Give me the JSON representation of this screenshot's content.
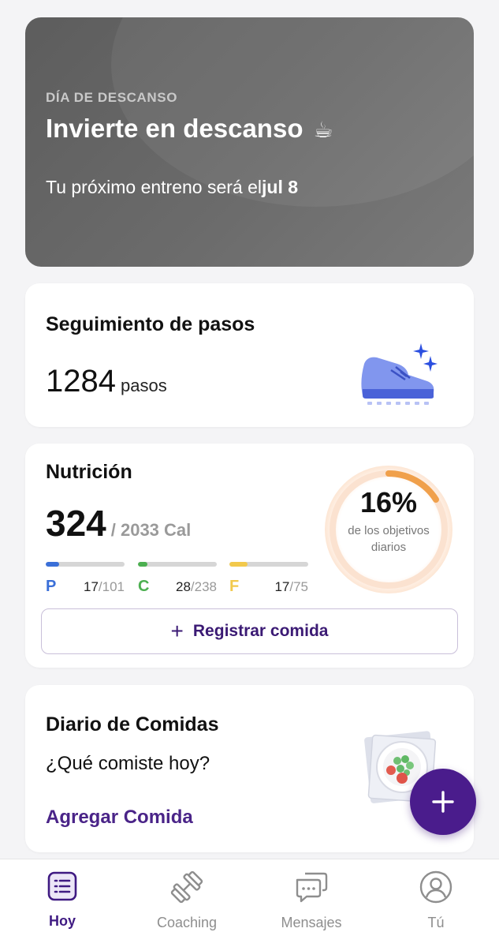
{
  "rest_day": {
    "eyebrow": "DÍA DE DESCANSO",
    "title": "Invierte en descanso",
    "title_emoji": "☕",
    "next_prefix": "Tu próximo entreno será el",
    "next_date": "jul 8"
  },
  "steps": {
    "title": "Seguimiento de pasos",
    "count": "1284",
    "unit": "pasos",
    "icon": "sneaker-icon"
  },
  "nutrition": {
    "title": "Nutrición",
    "calories": "324",
    "calories_goal": "/ 2033 Cal",
    "percent": "16%",
    "percent_value": 16,
    "percent_caption": "de los objetivos diarios",
    "macros": [
      {
        "letter": "P",
        "value": "17",
        "goal": "/101",
        "color": "#3a6fd8",
        "progress": 0.17
      },
      {
        "letter": "C",
        "value": "28",
        "goal": "/238",
        "color": "#4caf50",
        "progress": 0.12
      },
      {
        "letter": "F",
        "value": "17",
        "goal": "/75",
        "color": "#f2c94c",
        "progress": 0.23
      }
    ],
    "log_button": "Registrar comida"
  },
  "diary": {
    "title": "Diario de Comidas",
    "question": "¿Qué comiste hoy?",
    "add_link": "Agregar Comida"
  },
  "tabs": [
    {
      "label": "Hoy",
      "icon": "list-icon",
      "active": true
    },
    {
      "label": "Coaching",
      "icon": "dumbbell-icon",
      "active": false
    },
    {
      "label": "Mensajes",
      "icon": "chat-icon",
      "active": false
    },
    {
      "label": "Tú",
      "icon": "profile-icon",
      "active": false
    }
  ],
  "colors": {
    "brand": "#4a1c8c",
    "accent_ring": "#f0a04b"
  }
}
